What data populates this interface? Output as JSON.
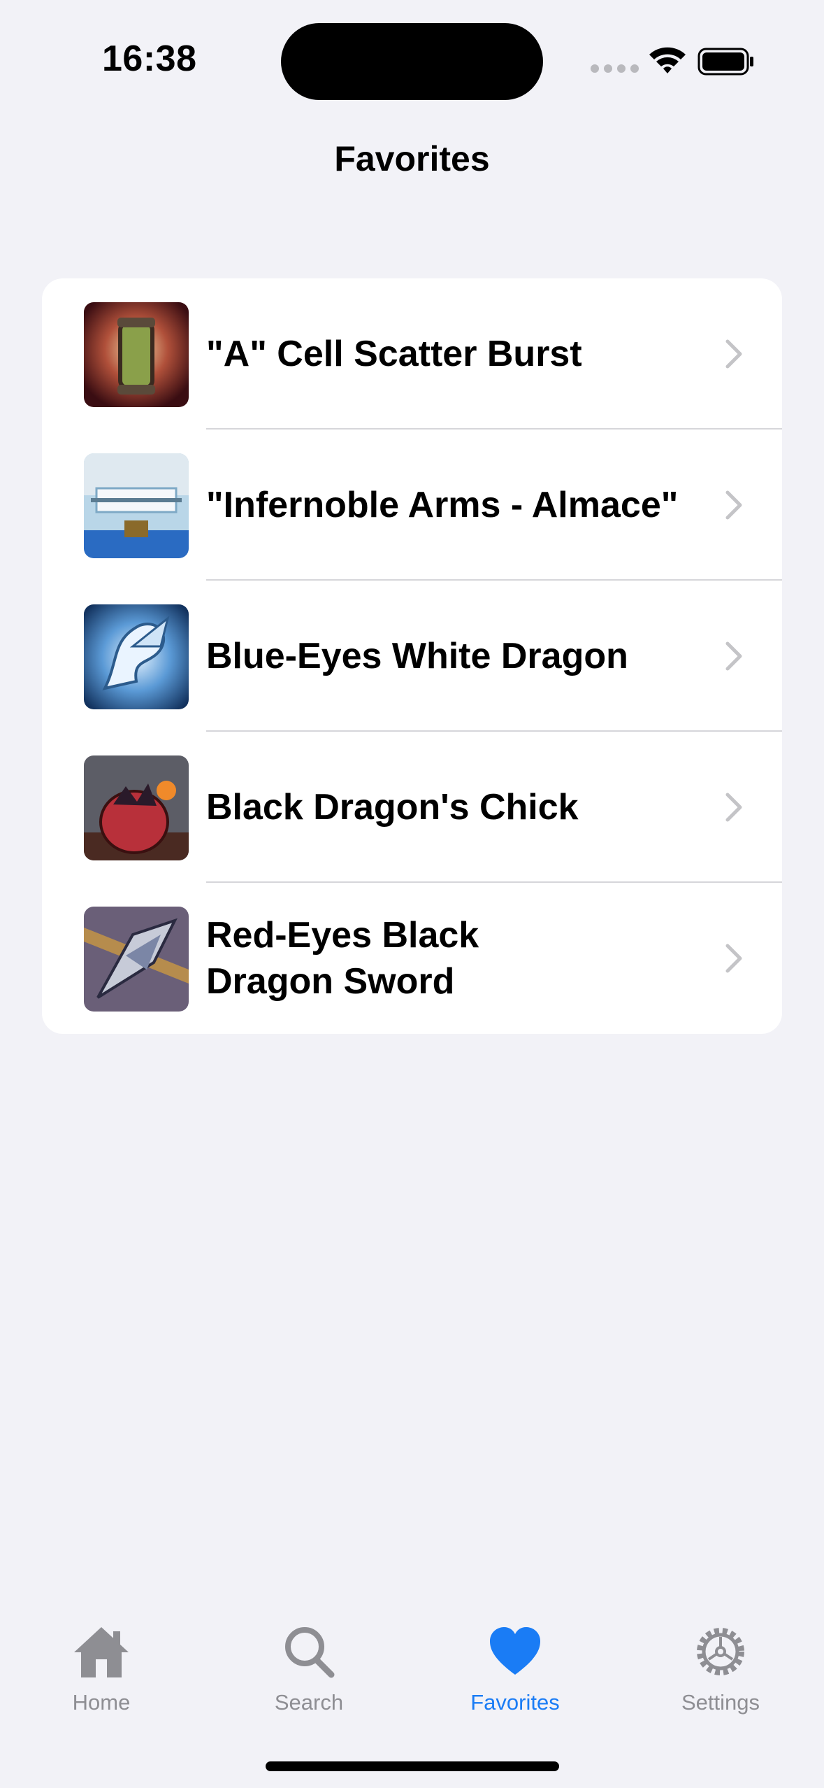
{
  "status": {
    "time": "16:38"
  },
  "nav": {
    "title": "Favorites"
  },
  "favorites": [
    {
      "title": "\"A\" Cell Scatter Burst",
      "thumb": "canister-art"
    },
    {
      "title": "\"Infernoble Arms - Almace\"",
      "thumb": "sword-case-art"
    },
    {
      "title": "Blue-Eyes White Dragon",
      "thumb": "white-dragon-art"
    },
    {
      "title": "Black Dragon's Chick",
      "thumb": "dragon-egg-art"
    },
    {
      "title": "Red-Eyes Black Dragon Sword",
      "thumb": "dragon-sword-art"
    }
  ],
  "tabs": [
    {
      "label": "Home",
      "icon": "house-icon"
    },
    {
      "label": "Search",
      "icon": "magnifier-icon"
    },
    {
      "label": "Favorites",
      "icon": "heart-icon",
      "active": true
    },
    {
      "label": "Settings",
      "icon": "gear-icon"
    }
  ],
  "colors": {
    "accent": "#1a7cf5",
    "inactive": "#8e8e93",
    "background": "#f2f2f7"
  }
}
